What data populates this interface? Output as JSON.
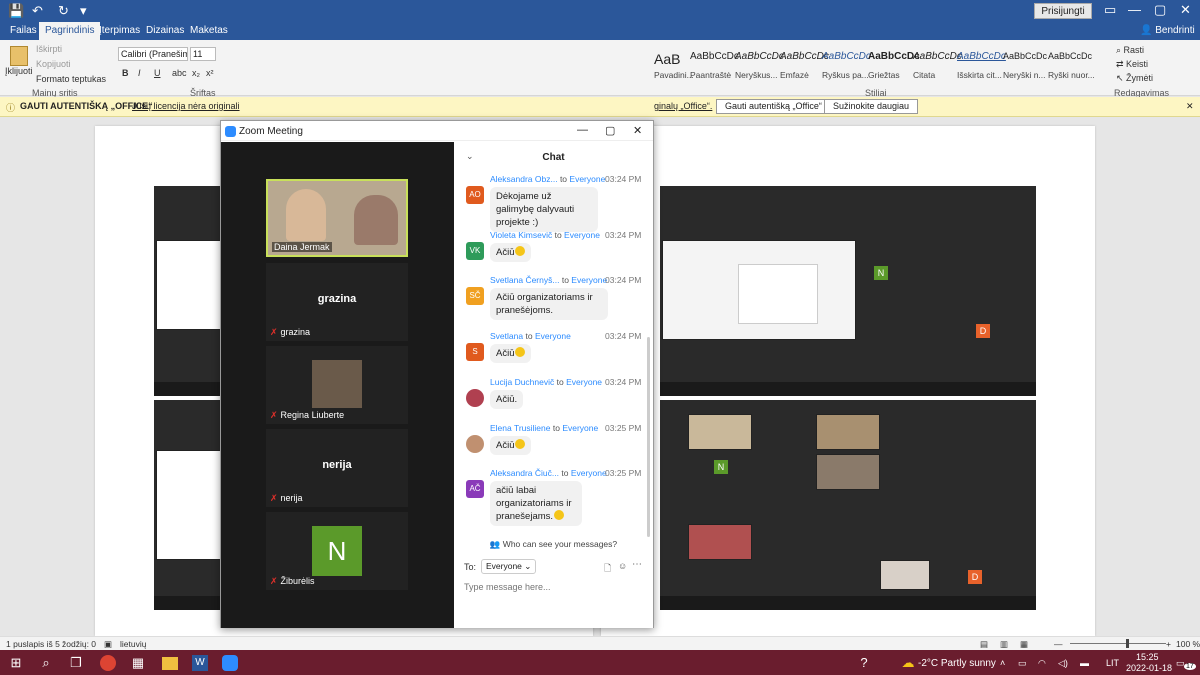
{
  "word": {
    "signin": "Prisijungti",
    "tabs": [
      "Failas",
      "Pagrindinis",
      "Įterpimas",
      "Dizainas",
      "Maketas"
    ],
    "share": "Bendrinti",
    "clipboard": {
      "paste": "Įklijuoti",
      "cut": "Iškirpti",
      "copy": "Kopijuoti",
      "format": "Formato teptukas",
      "label": "Mainų sritis"
    },
    "font": {
      "name": "Calibri (Pranešimų",
      "size": "11",
      "label": "Šriftas"
    },
    "styles": {
      "items": [
        {
          "preview": "AaB",
          "name": "Pavadini..."
        },
        {
          "preview": "AaBbCcDc",
          "name": "Paantraštė"
        },
        {
          "preview": "AaBbCcDc",
          "name": "Neryškus..."
        },
        {
          "preview": "AaBbCcDc",
          "name": "Emfazė"
        },
        {
          "preview": "AaBbCcDc",
          "name": "Ryškus pa..."
        },
        {
          "preview": "AaBbCcDc",
          "name": "Griežtas"
        },
        {
          "preview": "AaBbCcDc",
          "name": "Citata"
        },
        {
          "preview": "AaBbCcDc",
          "name": "Išskirta cit..."
        },
        {
          "preview": "AaBbCcDc",
          "name": "Neryški n..."
        },
        {
          "preview": "AaBbCcDc",
          "name": "Ryški nuor..."
        }
      ],
      "label": "Stiliai"
    },
    "editing": {
      "find": "Rasti",
      "replace": "Keisti",
      "select": "Žymėti",
      "label": "Redagavimas"
    },
    "msgbar": {
      "title": "GAUTI AUTENTIŠKĄ „OFFICE“",
      "text": "Jūsų licencija nėra originali",
      "text2": "ginalų „Office“.",
      "btn1": "Gauti autentišką „Office“",
      "btn2": "Sužinokite daugiau"
    },
    "status": {
      "page": "1 puslapis iš 5",
      "words": "žodžių: 0",
      "lang": "lietuvių",
      "zoom": "100 %"
    }
  },
  "zoom": {
    "title": "Zoom Meeting",
    "tiles": [
      {
        "name": "Daina Jermak",
        "type": "video"
      },
      {
        "name": "grazina",
        "big": "grazina",
        "type": "text"
      },
      {
        "name": "Regina Liuberte",
        "type": "photo"
      },
      {
        "name": "nerija",
        "big": "nerija",
        "type": "text"
      },
      {
        "name": "Žiburėlis",
        "letter": "N",
        "type": "letter"
      }
    ],
    "chat": {
      "header": "Chat",
      "to_word": "to",
      "messages": [
        {
          "initials": "AO",
          "color": "#e05a1e",
          "name": "Aleksandra Obz...",
          "to": "Everyone",
          "time": "03:24 PM",
          "text": "Dėkojame už galimybę dalyvauti projekte :)"
        },
        {
          "initials": "VK",
          "color": "#2e9b5a",
          "name": "Violeta Kimsevič",
          "to": "Everyone",
          "time": "03:24 PM",
          "text": "Ačiū"
        },
        {
          "initials": "SČ",
          "color": "#f0a020",
          "name": "Svetlana Černyš...",
          "to": "Everyone",
          "time": "03:24 PM",
          "text": "Ačiū organizatoriams ir pranešėjoms."
        },
        {
          "initials": "S",
          "color": "#e05a1e",
          "name": "Svetlana",
          "to": "Everyone",
          "time": "03:24 PM",
          "text": "Ačiū"
        },
        {
          "initials": "",
          "color": "#b04050",
          "name": "Lucija Duchnevič",
          "to": "Everyone",
          "time": "03:24 PM",
          "text": "Ačiū."
        },
        {
          "initials": "",
          "color": "#c09070",
          "name": "Elena Trusiliene",
          "to": "Everyone",
          "time": "03:25 PM",
          "text": "Ačiū"
        },
        {
          "initials": "AČ",
          "color": "#8a3ab9",
          "name": "Aleksandra Čiuč...",
          "to": "Everyone",
          "time": "03:25 PM",
          "text": "ačiū labai organizatoriams ir pranešejams."
        }
      ],
      "who_can_see": "Who can see your messages?",
      "to_label": "To:",
      "to_value": "Everyone",
      "placeholder": "Type message here..."
    }
  },
  "taskbar": {
    "weather": "-2°C  Partly sunny",
    "lang": "LIT",
    "time": "15:25",
    "date": "2022-01-18",
    "notif": "17"
  }
}
